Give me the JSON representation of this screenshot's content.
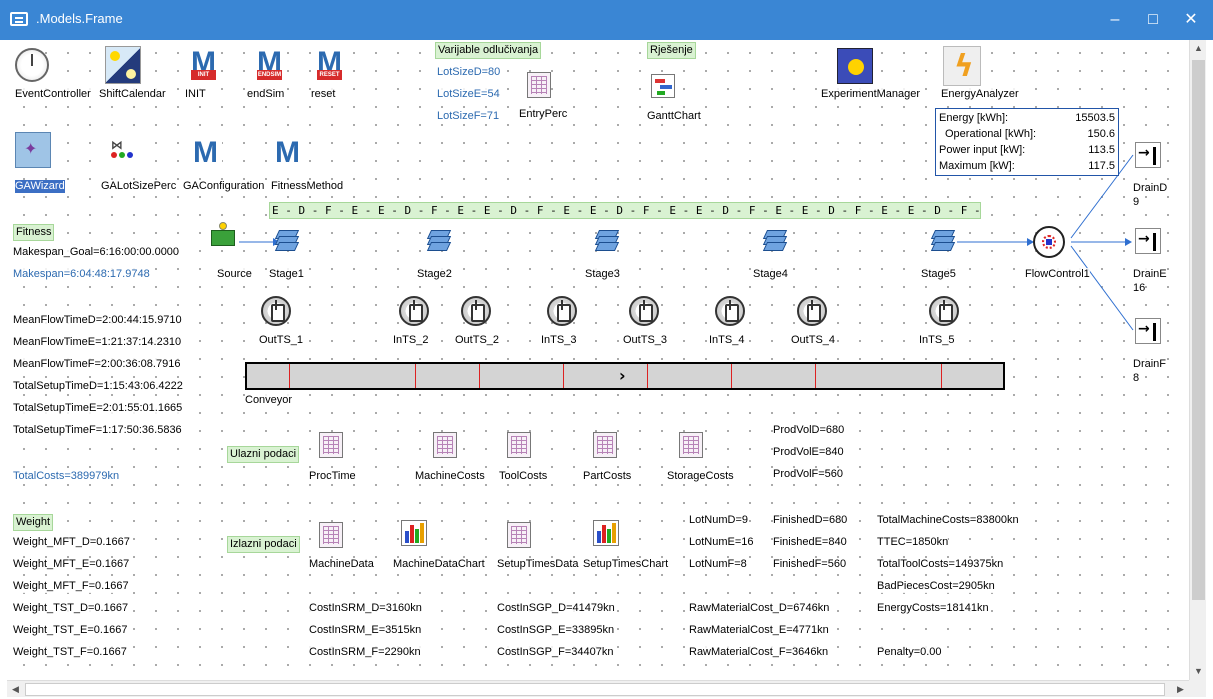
{
  "window": {
    "title": ".Models.Frame"
  },
  "top_icons": {
    "event_controller": "EventController",
    "shift_calendar": "ShiftCalendar",
    "init": "INIT",
    "init_tag": "INIT",
    "endsim": "endSim",
    "endsim_tag": "ENDSIM",
    "reset": "reset",
    "reset_tag": "RESET",
    "entry_perc": "EntryPerc",
    "gantt_chart": "GanttChart",
    "experiment_manager": "ExperimentManager",
    "energy_analyzer": "EnergyAnalyzer",
    "ga_wizard": "GAWizard",
    "ga_lot_size_perc": "GALotSizePerc",
    "ga_configuration": "GAConfiguration",
    "fitness_method": "FitnessMethod"
  },
  "decision_vars": {
    "header": "Varijable odlučivanja",
    "lot_d": "LotSizeD=80",
    "lot_e": "LotSizeE=54",
    "lot_f": "LotSizeF=71"
  },
  "solution_header": "Rješenje",
  "energy": {
    "rows": [
      {
        "label": "Energy [kWh]:",
        "value": "15503.5"
      },
      {
        "label": "Operational [kWh]:",
        "value": "150.6"
      },
      {
        "label": "Power input [kW]:",
        "value": "113.5"
      },
      {
        "label": "Maximum [kW]:",
        "value": "117.5"
      }
    ]
  },
  "sequence": "E - D - F - E - E - D - F - E - E - D - F - E - E - D - F - E - E - D - F - E - E - D - F - E - E - D - F - E - D -",
  "fitness": {
    "header": "Fitness",
    "goal": "Makespan_Goal=6:16:00:00.0000",
    "makespan": "Makespan=6:04:48:17.9748",
    "mft_d": "MeanFlowTimeD=2:00:44:15.9710",
    "mft_e": "MeanFlowTimeE=1:21:37:14.2310",
    "mft_f": "MeanFlowTimeF=2:00:36:08.7916",
    "tst_d": "TotalSetupTimeD=1:15:43:06.4222",
    "tst_e": "TotalSetupTimeE=2:01:55:01.1665",
    "tst_f": "TotalSetupTimeF=1:17:50:36.5836",
    "total_costs": "TotalCosts=389979kn"
  },
  "flow": {
    "source": "Source",
    "stages": [
      "Stage1",
      "Stage2",
      "Stage3",
      "Stage4",
      "Stage5"
    ],
    "stores": [
      "OutTS_1",
      "InTS_2",
      "OutTS_2",
      "InTS_3",
      "OutTS_3",
      "InTS_4",
      "OutTS_4",
      "InTS_5"
    ],
    "conveyor": "Conveyor",
    "conveyor_arrow": "›",
    "flow_control": "FlowControl1",
    "drains": [
      {
        "name": "DrainD",
        "count": "9"
      },
      {
        "name": "DrainE",
        "count": "16"
      },
      {
        "name": "DrainF",
        "count": "8"
      }
    ]
  },
  "input_data": {
    "header": "Ulazni podaci",
    "tables": [
      "ProcTime",
      "MachineCosts",
      "ToolCosts",
      "PartCosts",
      "StorageCosts"
    ],
    "prod_d": "ProdVolD=680",
    "prod_e": "ProdVolE=840",
    "prod_f": "ProdVolF=560"
  },
  "output_data": {
    "header": "Izlazni podaci",
    "machine_data": "MachineData",
    "machine_data_chart": "MachineDataChart",
    "setup_times_data": "SetupTimesData",
    "setup_times_chart": "SetupTimesChart",
    "lotnum_d": "LotNumD=9",
    "lotnum_e": "LotNumE=16",
    "lotnum_f": "LotNumF=8",
    "finished_d": "FinishedD=680",
    "finished_e": "FinishedE=840",
    "finished_f": "FinishedF=560",
    "total_machine_costs": "TotalMachineCosts=83800kn",
    "ttec": "TTEC=1850kn",
    "total_tool_costs": "TotalToolCosts=149375kn",
    "bad_pieces_cost": "BadPiecesCost=2905kn",
    "energy_costs": "EnergyCosts=18141kn",
    "penalty": "Penalty=0.00"
  },
  "weights": {
    "header": "Weight",
    "mft_d": "Weight_MFT_D=0.1667",
    "mft_e": "Weight_MFT_E=0.1667",
    "mft_f": "Weight_MFT_F=0.1667",
    "tst_d": "Weight_TST_D=0.1667",
    "tst_e": "Weight_TST_E=0.1667",
    "tst_f": "Weight_TST_F=0.1667"
  },
  "costs": {
    "srm_d": "CostInSRM_D=3160kn",
    "srm_e": "CostInSRM_E=3515kn",
    "srm_f": "CostInSRM_F=2290kn",
    "sgp_d": "CostInSGP_D=41479kn",
    "sgp_e": "CostInSGP_E=33895kn",
    "sgp_f": "CostInSGP_F=34407kn",
    "raw_d": "RawMaterialCost_D=6746kn",
    "raw_e": "RawMaterialCost_E=4771kn",
    "raw_f": "RawMaterialCost_F=3646kn"
  }
}
